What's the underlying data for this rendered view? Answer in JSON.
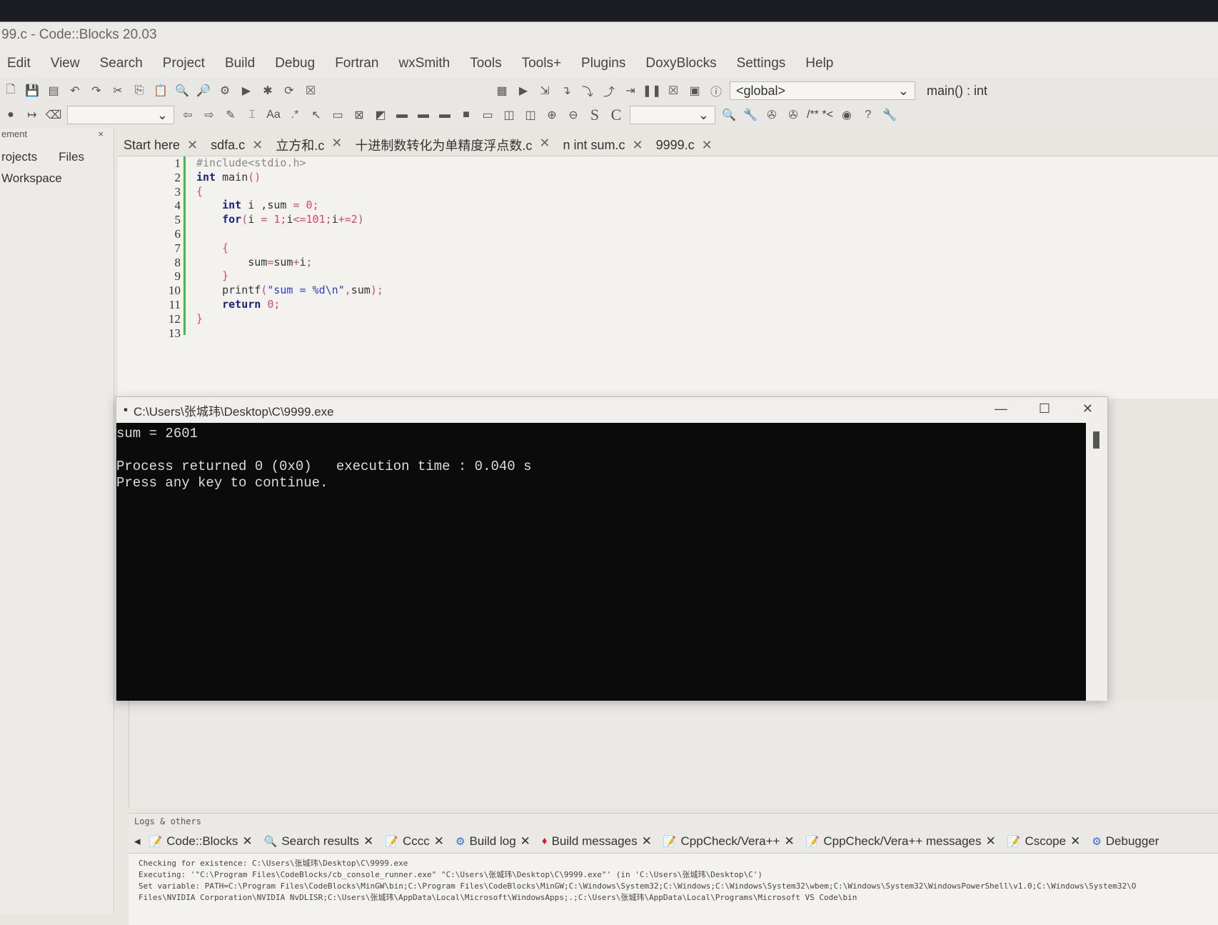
{
  "window": {
    "title": "99.c - Code::Blocks 20.03"
  },
  "menu": [
    "Edit",
    "View",
    "Search",
    "Project",
    "Build",
    "Debug",
    "Fortran",
    "wxSmith",
    "Tools",
    "Tools+",
    "Plugins",
    "DoxyBlocks",
    "Settings",
    "Help"
  ],
  "toolbar": {
    "scope": "<global>",
    "function": "main() : int",
    "s_label": "S",
    "c_label": "C",
    "doxy": "/** *<"
  },
  "left_panel": {
    "header": "ement",
    "tabs": [
      "rojects",
      "Files"
    ],
    "workspace": "Workspace"
  },
  "editor_tabs": [
    "Start here",
    "sdfa.c",
    "立方和.c",
    "十进制数转化为单精度浮点数.c",
    "n int sum.c",
    "9999.c"
  ],
  "code": [
    [
      [
        "p",
        "#include<stdio.h>"
      ]
    ],
    [
      [
        "k",
        "int"
      ],
      [
        "t",
        " main"
      ],
      [
        "o",
        "()"
      ]
    ],
    [
      [
        "o",
        "{"
      ]
    ],
    [
      [
        "t",
        "    "
      ],
      [
        "k",
        "int"
      ],
      [
        "t",
        " i ,sum "
      ],
      [
        "o",
        "="
      ],
      [
        "t",
        " "
      ],
      [
        "n",
        "0"
      ],
      [
        "o",
        ";"
      ]
    ],
    [
      [
        "t",
        "    "
      ],
      [
        "k",
        "for"
      ],
      [
        "o",
        "("
      ],
      [
        "t",
        "i "
      ],
      [
        "o",
        "="
      ],
      [
        "t",
        " "
      ],
      [
        "n",
        "1"
      ],
      [
        "o",
        ";"
      ],
      [
        "t",
        "i"
      ],
      [
        "o",
        "<="
      ],
      [
        "n",
        "101"
      ],
      [
        "o",
        ";"
      ],
      [
        "t",
        "i"
      ],
      [
        "o",
        "+="
      ],
      [
        "n",
        "2"
      ],
      [
        "o",
        ")"
      ]
    ],
    [],
    [
      [
        "t",
        "    "
      ],
      [
        "o",
        "{"
      ]
    ],
    [
      [
        "t",
        "        sum"
      ],
      [
        "o",
        "="
      ],
      [
        "t",
        "sum"
      ],
      [
        "o",
        "+"
      ],
      [
        "t",
        "i"
      ],
      [
        "o",
        ";"
      ]
    ],
    [
      [
        "t",
        "    "
      ],
      [
        "o",
        "}"
      ]
    ],
    [
      [
        "t",
        "    printf"
      ],
      [
        "o",
        "("
      ],
      [
        "s",
        "\"sum = %d\\n\""
      ],
      [
        "o",
        ","
      ],
      [
        "t",
        "sum"
      ],
      [
        "o",
        ");"
      ]
    ],
    [
      [
        "t",
        "    "
      ],
      [
        "k",
        "return"
      ],
      [
        "t",
        " "
      ],
      [
        "n",
        "0"
      ],
      [
        "o",
        ";"
      ]
    ],
    [
      [
        "o",
        "}"
      ]
    ],
    []
  ],
  "console": {
    "title": "C:\\Users\\张城玮\\Desktop\\C\\9999.exe",
    "output": "sum = 2601\n\nProcess returned 0 (0x0)   execution time : 0.040 s\nPress any key to continue."
  },
  "logs": {
    "header": "Logs & others",
    "tabs": [
      "Code::Blocks",
      "Search results",
      "Cccc",
      "Build log",
      "Build messages",
      "CppCheck/Vera++",
      "CppCheck/Vera++ messages",
      "Cscope",
      "Debugger"
    ],
    "lines": [
      "Checking for existence: C:\\Users\\张城玮\\Desktop\\C\\9999.exe",
      "Executing: '\"C:\\Program Files\\CodeBlocks/cb_console_runner.exe\" \"C:\\Users\\张城玮\\Desktop\\C\\9999.exe\"' (in 'C:\\Users\\张城玮\\Desktop\\C')",
      "Set variable: PATH=C:\\Program Files\\CodeBlocks\\MinGW\\bin;C:\\Program Files\\CodeBlocks\\MinGW;C:\\Windows\\System32;C:\\Windows;C:\\Windows\\System32\\wbem;C:\\Windows\\System32\\WindowsPowerShell\\v1.0;C:\\Windows\\System32\\O",
      "Files\\NVIDIA Corporation\\NVIDIA NvDLISR;C:\\Users\\张城玮\\AppData\\Local\\Microsoft\\WindowsApps;.;C:\\Users\\张城玮\\AppData\\Local\\Programs\\Microsoft VS Code\\bin"
    ]
  }
}
